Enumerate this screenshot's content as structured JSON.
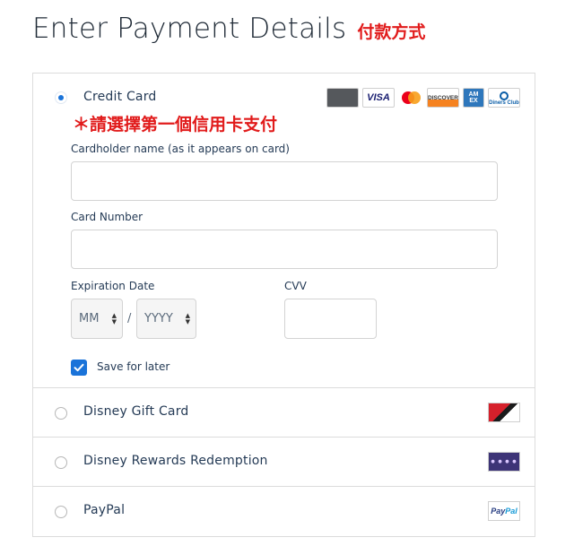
{
  "header": {
    "title": "Enter Payment Details",
    "note": "付款方式"
  },
  "credit_card": {
    "label": "Credit Card",
    "selected": true,
    "note": "＊請選擇第一個信用卡支付",
    "logos": {
      "visa": "VISA",
      "discover": "DISCOVER",
      "amex_line1": "AM",
      "amex_line2": "EX",
      "diners": "Diners Club"
    },
    "fields": {
      "cardholder_label": "Cardholder name (as it appears on card)",
      "cardholder_value": "",
      "number_label": "Card Number",
      "number_value": "",
      "expiration_label": "Expiration Date",
      "month_value": "MM",
      "year_value": "YYYY",
      "separator": "/",
      "cvv_label": "CVV",
      "cvv_value": ""
    },
    "save_for_later": {
      "label": "Save for later",
      "checked": true
    }
  },
  "other_options": {
    "gift_card": {
      "label": "Disney Gift Card",
      "icon": "disney-gift-card-image"
    },
    "rewards": {
      "label": "Disney Rewards Redemption",
      "icon": "disney-rewards-card-image"
    },
    "paypal": {
      "label": "PayPal",
      "logo_part1": "Pay",
      "logo_part2": "Pal"
    }
  },
  "colors": {
    "accent": "#1a73d9",
    "note_red": "#e11b1b",
    "text": "#253b56",
    "border": "#dcdcdc"
  }
}
